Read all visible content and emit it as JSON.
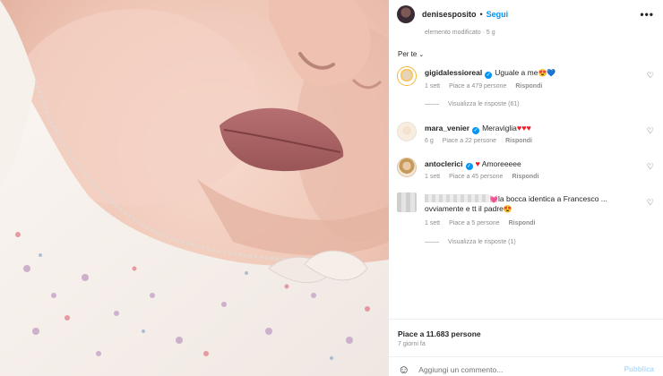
{
  "post": {
    "username": "denisesposito",
    "separator": "•",
    "follow_label": "Segui",
    "more_label": "•••",
    "edited_note": "elemento modificato · 5 g",
    "filter_label": "Per te",
    "likes": "Piace a 11.683 persone",
    "time_ago": "7 giorni fa",
    "comment_placeholder": "Aggiungi un commento...",
    "publish_label": "Pubblica"
  },
  "comments": [
    {
      "username": "gigidalessioreal",
      "text": "Uguale a me",
      "emoji": "😍💙",
      "time": "1 sett",
      "likes": "Piace a 479 persone",
      "reply": "Rispondi",
      "view_replies": "Visualizza le risposte (61)"
    },
    {
      "username": "mara_venier",
      "text": "Meraviglia",
      "emoji": "♥♥♥",
      "time": "6 g",
      "likes": "Piace a 22 persone",
      "reply": "Rispondi"
    },
    {
      "username": "antoclerici",
      "text": "Amoreeeee",
      "emoji": "♥",
      "time": "1 sett",
      "likes": "Piace a 45 persone",
      "reply": "Rispondi"
    },
    {
      "text_line1": "la bocca identica a Francesco ...",
      "text_line2": "ovviamente e tt il padre",
      "emoji_start": "💓",
      "emoji_end": "😍",
      "time": "1 sett",
      "likes": "Piace a 5 persone",
      "reply": "Rispondi",
      "view_replies": "Visualizza le risposte (1)"
    }
  ],
  "colors": {
    "link_blue": "#0095f6",
    "meta_gray": "#8e8e8e",
    "heart_red": "#ed1c24"
  },
  "icons": [
    "more-icon",
    "verified-icon",
    "heart-icon",
    "emoji-icon"
  ]
}
